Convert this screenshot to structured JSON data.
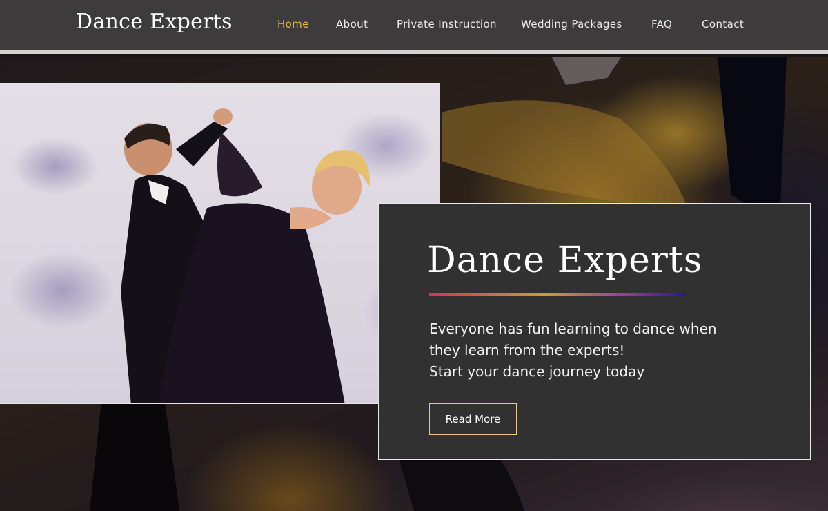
{
  "header": {
    "logo": "Dance Experts",
    "nav": [
      {
        "label": "Home",
        "active": true
      },
      {
        "label": "About",
        "active": false
      },
      {
        "label": "Private Instruction",
        "active": false
      },
      {
        "label": "Wedding Packages",
        "active": false
      },
      {
        "label": "FAQ",
        "active": false
      },
      {
        "label": "Contact",
        "active": false
      }
    ]
  },
  "colors": {
    "header_bg": "#3d3b3c",
    "nav_active": "#e8b64a",
    "card_bg": "#323132",
    "button_border": "#e8c98a"
  },
  "hero": {
    "title": "Dance Experts",
    "lines": [
      "Everyone has fun learning to dance when",
      "they learn from the experts!",
      "Start your dance journey today"
    ],
    "button_label": "Read More"
  }
}
